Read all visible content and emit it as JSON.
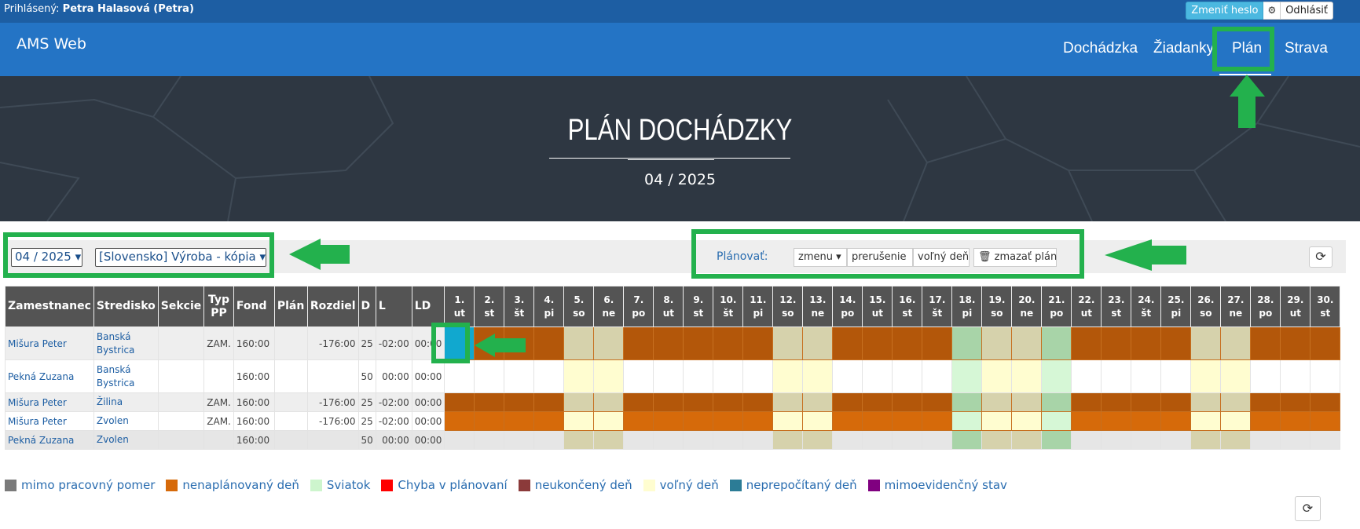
{
  "topbar": {
    "login_label": "Prihlásený:",
    "user": "Petra Halasová (Petra)",
    "change_password": "Zmeniť heslo",
    "gear_icon": "gear-icon",
    "logout": "Odhlásiť"
  },
  "nav": {
    "brand": "AMS Web",
    "items": [
      "Dochádzka",
      "Žiadanky",
      "Plán",
      "Strava"
    ],
    "active": "Plán"
  },
  "hero": {
    "title": "PLÁN DOCHÁDZKY",
    "subtitle": "04 / 2025"
  },
  "filters": {
    "month": "04 / 2025",
    "center": "[Slovensko] Výroba - kópia",
    "plan_label": "Plánovať:",
    "shift_button": "zmenu",
    "interrupt_button": "prerušenie",
    "free_day_button": "voľný deň",
    "delete_plan_button": "zmazať plán",
    "refresh_icon": "refresh-icon"
  },
  "table": {
    "headers": [
      "Zamestnanec",
      "Stredisko",
      "Sekcie",
      "Typ PP",
      "Fond",
      "Plán",
      "Rozdiel",
      "D",
      "L",
      "LD"
    ],
    "days": [
      {
        "n": "1.",
        "d": "ut"
      },
      {
        "n": "2.",
        "d": "st"
      },
      {
        "n": "3.",
        "d": "št"
      },
      {
        "n": "4.",
        "d": "pi"
      },
      {
        "n": "5.",
        "d": "so"
      },
      {
        "n": "6.",
        "d": "ne"
      },
      {
        "n": "7.",
        "d": "po"
      },
      {
        "n": "8.",
        "d": "ut"
      },
      {
        "n": "9.",
        "d": "st"
      },
      {
        "n": "10.",
        "d": "št"
      },
      {
        "n": "11.",
        "d": "pi"
      },
      {
        "n": "12.",
        "d": "so"
      },
      {
        "n": "13.",
        "d": "ne"
      },
      {
        "n": "14.",
        "d": "po"
      },
      {
        "n": "15.",
        "d": "ut"
      },
      {
        "n": "16.",
        "d": "st"
      },
      {
        "n": "17.",
        "d": "št"
      },
      {
        "n": "18.",
        "d": "pi"
      },
      {
        "n": "19.",
        "d": "so"
      },
      {
        "n": "20.",
        "d": "ne"
      },
      {
        "n": "21.",
        "d": "po"
      },
      {
        "n": "22.",
        "d": "ut"
      },
      {
        "n": "23.",
        "d": "st"
      },
      {
        "n": "24.",
        "d": "št"
      },
      {
        "n": "25.",
        "d": "pi"
      },
      {
        "n": "26.",
        "d": "so"
      },
      {
        "n": "27.",
        "d": "ne"
      },
      {
        "n": "28.",
        "d": "po"
      },
      {
        "n": "29.",
        "d": "ut"
      },
      {
        "n": "30.",
        "d": "st"
      }
    ],
    "rows": [
      {
        "employee": "Mišura Peter",
        "center": "Banská Bystrica",
        "sections": "",
        "type": "ZAM.",
        "fund": "160:00",
        "plan": "",
        "diff": "-176:00",
        "d": "25",
        "l": "-02:00",
        "ld": "00:00",
        "pattern": "orange_dark",
        "selected_day": 1
      },
      {
        "employee": "Pekná Zuzana",
        "center": "Banská Bystrica",
        "sections": "",
        "type": "",
        "fund": "160:00",
        "plan": "",
        "diff": "",
        "d": "50",
        "l": "00:00",
        "ld": "00:00",
        "pattern": "white"
      },
      {
        "employee": "Mišura Peter",
        "center": "Žilina",
        "sections": "",
        "type": "ZAM.",
        "fund": "160:00",
        "plan": "",
        "diff": "-176:00",
        "d": "25",
        "l": "-02:00",
        "ld": "00:00",
        "pattern": "orange_dark"
      },
      {
        "employee": "Mišura Peter",
        "center": "Zvolen",
        "sections": "",
        "type": "ZAM.",
        "fund": "160:00",
        "plan": "",
        "diff": "-176:00",
        "d": "25",
        "l": "-02:00",
        "ld": "00:00",
        "pattern": "orange"
      },
      {
        "employee": "Pekná Zuzana",
        "center": "Zvolen",
        "sections": "",
        "type": "",
        "fund": "160:00",
        "plan": "",
        "diff": "",
        "d": "50",
        "l": "00:00",
        "ld": "00:00",
        "pattern": "grey"
      }
    ],
    "weekend_days": [
      5,
      6,
      12,
      13,
      19,
      20,
      26,
      27
    ],
    "holiday_days": [
      18,
      21
    ]
  },
  "colors": {
    "orange_dark": "#b3570a",
    "orange": "#d66a0a",
    "grey": "#e6e6e6",
    "white": "#ffffff",
    "weekend_on_dark": "#d6d2ac",
    "weekend_on_light": "#fffdd0",
    "weekend_on_grey": "#d6d2ac",
    "holiday_on_dark": "#a8d4a8",
    "holiday_on_light": "#d6f7d6",
    "selected": "#11a8cf",
    "highlight": "#23b14d"
  },
  "legend": [
    {
      "label": "mimo pracovný pomer",
      "color": "#7a7a7a"
    },
    {
      "label": "nenaplánovaný deň",
      "color": "#d66a0a"
    },
    {
      "label": "Sviatok",
      "color": "#cdf5cd"
    },
    {
      "label": "Chyba v plánovaní",
      "color": "#ff0000"
    },
    {
      "label": "neukončený deň",
      "color": "#8b3a3a"
    },
    {
      "label": "voľný deň",
      "color": "#fffdd0"
    },
    {
      "label": "neprepočítaný deň",
      "color": "#2c7c96"
    },
    {
      "label": "mimoevidenčný stav",
      "color": "#800080"
    }
  ]
}
